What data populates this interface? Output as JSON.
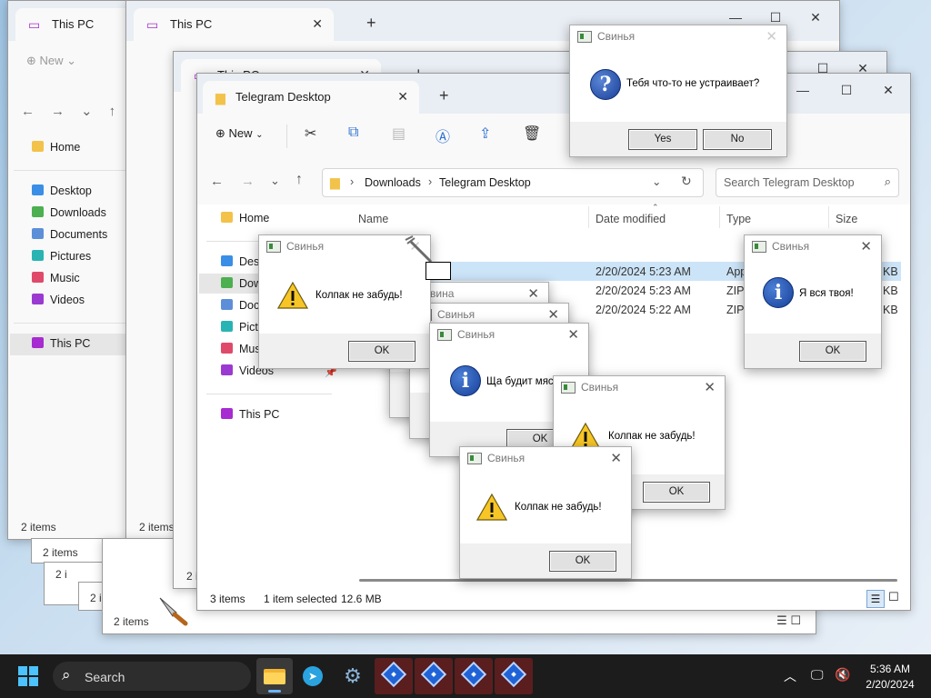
{
  "colors": {
    "accent": "#0078d4",
    "taskbar": "#1c1c1c",
    "dialog_footer": "#f0f0f0",
    "selection": "#cce4f7"
  },
  "back_windows": [
    {
      "tab_title": "This PC",
      "new_label": "New",
      "nav": [
        "Home",
        "Desktop",
        "Downloads",
        "Documents",
        "Pictures",
        "Music",
        "Videos",
        "This PC"
      ],
      "status": "2 items"
    },
    {
      "tab_title": "This PC",
      "status": "2 items"
    },
    {
      "tab_title": "This PC",
      "status": "2 items"
    }
  ],
  "cascade_status": [
    "2 items",
    "2 i",
    "2 i",
    "2 i",
    "2 items"
  ],
  "main_window": {
    "tab_title": "Telegram Desktop",
    "new_label": "New",
    "breadcrumb": [
      "Downloads",
      "Telegram Desktop"
    ],
    "search_placeholder": "Search Telegram Desktop",
    "nav": {
      "home": "Home",
      "desktop": "Desk",
      "downloads": "Dow",
      "documents": "Doc",
      "pictures": "Pict",
      "music": "Mus",
      "videos": "Videos",
      "this_pc": "This PC"
    },
    "columns": [
      "Name",
      "Date modified",
      "Type",
      "Size"
    ],
    "rows": [
      {
        "date": "2/20/2024 5:23 AM",
        "type": "App",
        "size": "KB",
        "selected": true
      },
      {
        "date": "2/20/2024 5:23 AM",
        "type": "ZIP",
        "size": "KB",
        "selected": false
      },
      {
        "date": "2/20/2024 5:22 AM",
        "type": "ZIP",
        "size": "KB",
        "selected": false
      }
    ],
    "status": {
      "count": "3 items",
      "selected": "1 item selected",
      "size": "12.6 MB"
    }
  },
  "dialogs": {
    "title": "Свинья",
    "question": {
      "message": "Тебя что-то не устраивает?",
      "yes": "Yes",
      "no": "No"
    },
    "warn_1": {
      "message": "Колпак не забудь!",
      "ok": "OK"
    },
    "info_right": {
      "message": "Я вся твоя!",
      "ok": "OK"
    },
    "info_mid": {
      "message": "Ща будит мяс",
      "ok": "OK"
    },
    "warn_2": {
      "message": "Колпак не забудь!",
      "ok": "OK"
    },
    "warn_3": {
      "message": "Колпак не забудь!",
      "ok": "OK"
    },
    "stacked_titles": [
      "вина",
      "Свинья"
    ]
  },
  "taskbar": {
    "search_label": "Search",
    "time": "5:36 AM",
    "date": "2/20/2024",
    "apps": [
      "start-icon",
      "file-explorer-icon",
      "telegram-icon",
      "settings-icon",
      "app-icon",
      "app-icon",
      "app-icon",
      "app-icon"
    ]
  }
}
